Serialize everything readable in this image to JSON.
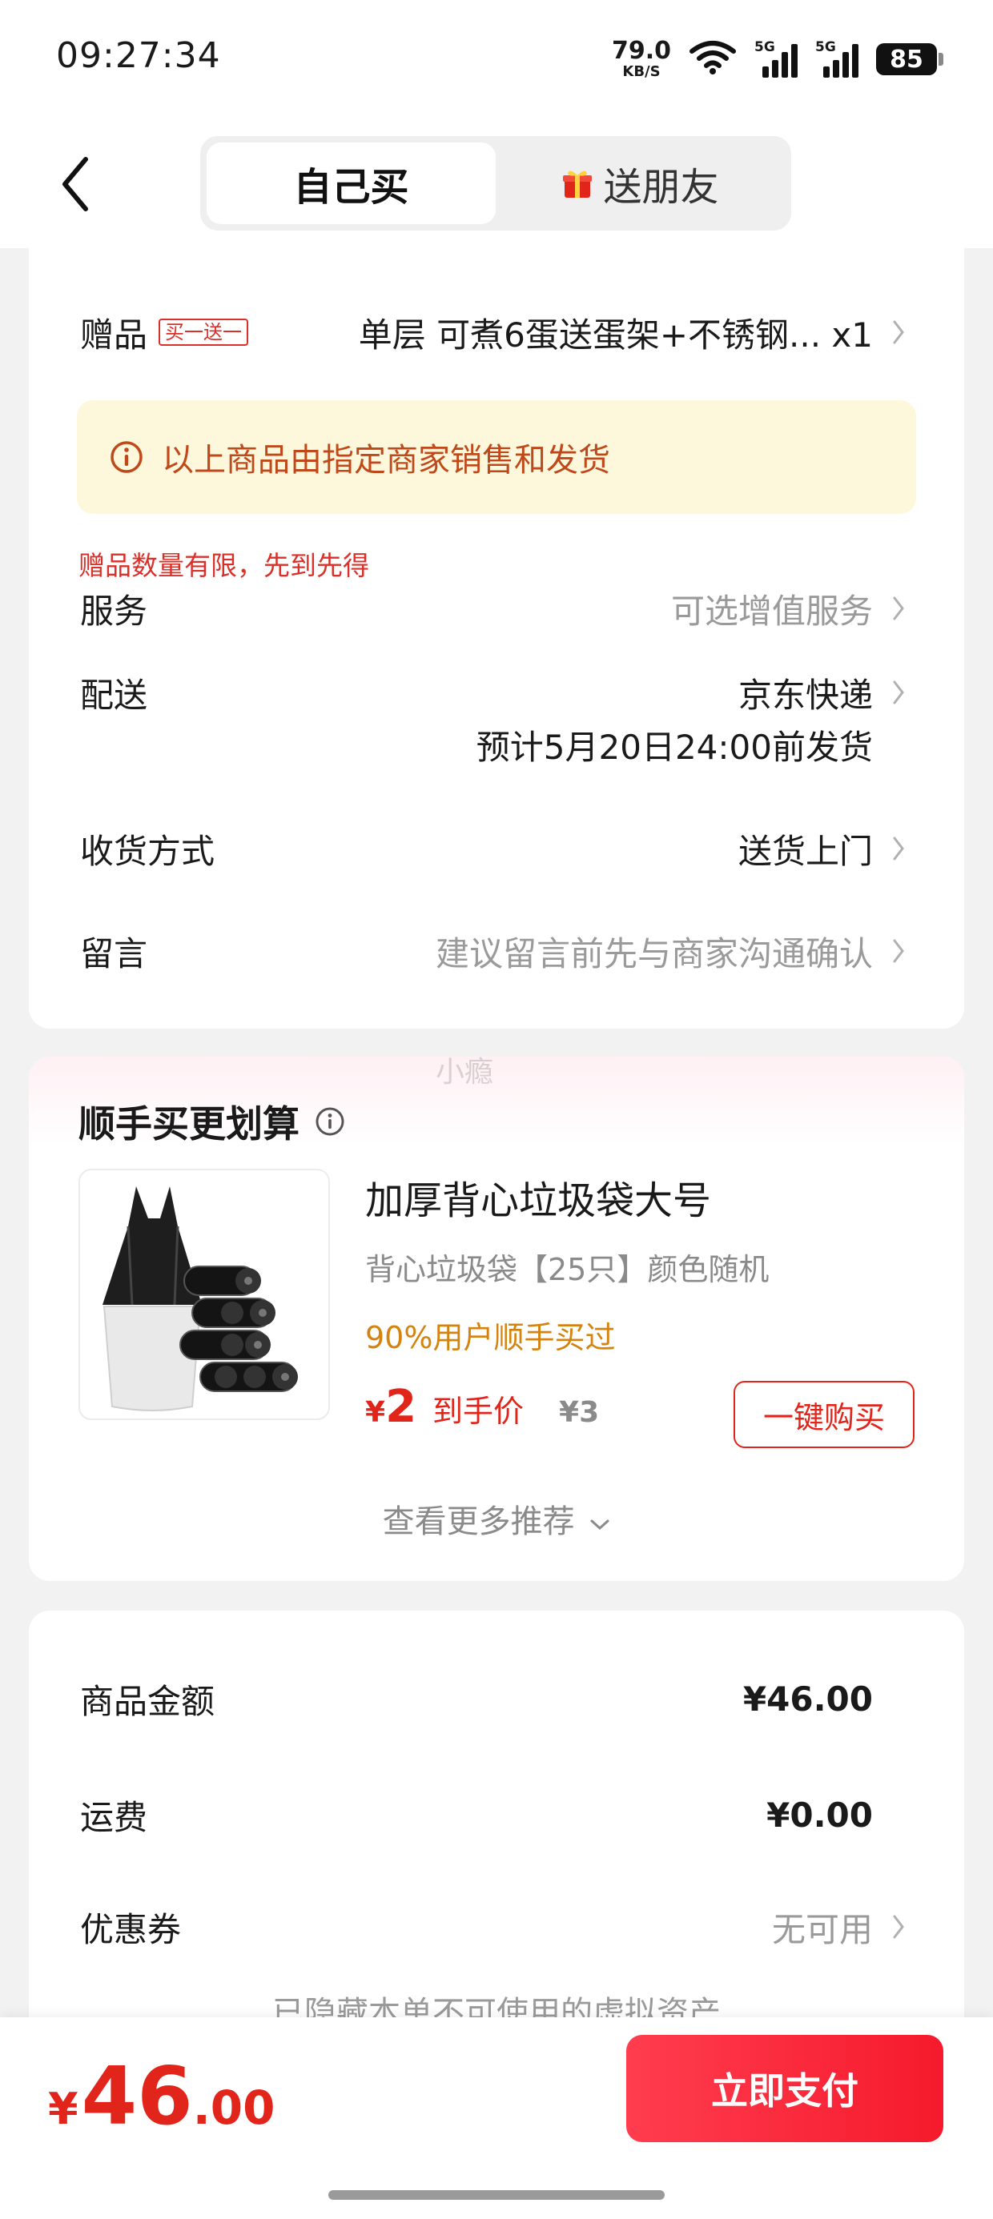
{
  "status_bar": {
    "time": "09:27:34",
    "net_speed_value": "79.0",
    "net_speed_unit": "KB/S",
    "signal_1_label": "5G",
    "signal_2_label": "5G",
    "battery": "85",
    "icons": [
      "wifi-icon",
      "signal-icon",
      "battery-icon"
    ]
  },
  "header": {
    "tabs": [
      {
        "label": "自己买",
        "active": true
      },
      {
        "label": "送朋友",
        "active": false,
        "icon": "gift-icon"
      }
    ]
  },
  "order": {
    "gift": {
      "label": "赠品",
      "badge": "买一送一",
      "value": "单层 可煮6蛋送蛋架+不锈钢... x1"
    },
    "notice": "以上商品由指定商家销售和发货",
    "limit_tip": "赠品数量有限，先到先得",
    "service": {
      "label": "服务",
      "value": "可选增值服务"
    },
    "delivery": {
      "label": "配送",
      "value": "京东快递",
      "eta": "预计5月20日24:00前发货"
    },
    "receive": {
      "label": "收货方式",
      "value": "送货上门"
    },
    "message": {
      "label": "留言",
      "placeholder": "建议留言前先与商家沟通确认"
    }
  },
  "watermark": "小瘾",
  "upsell": {
    "title": "顺手买更划算",
    "product": {
      "name": "加厚背心垃圾袋大号",
      "spec": "背心垃圾袋【25只】颜色随机",
      "social": "90%用户顺手买过",
      "currency": "¥",
      "price": "2",
      "price_label": "到手价",
      "original_price": "¥3",
      "buy_label": "一键购买"
    },
    "more": "查看更多推荐"
  },
  "summary": {
    "goods": {
      "label": "商品金额",
      "value": "¥46.00"
    },
    "shipping": {
      "label": "运费",
      "value": "¥0.00"
    },
    "coupon": {
      "label": "优惠券",
      "value": "无可用"
    },
    "hidden_note": "已隐藏本单不可使用的虚拟资产"
  },
  "bottom": {
    "currency": "¥",
    "total_int": "46",
    "total_dec": ".00",
    "pay_label": "立即支付"
  },
  "colors": {
    "accent": "#e1251b",
    "notice_bg": "#fdf8dc",
    "notice_text": "#c0491b",
    "social": "#d4830f"
  }
}
